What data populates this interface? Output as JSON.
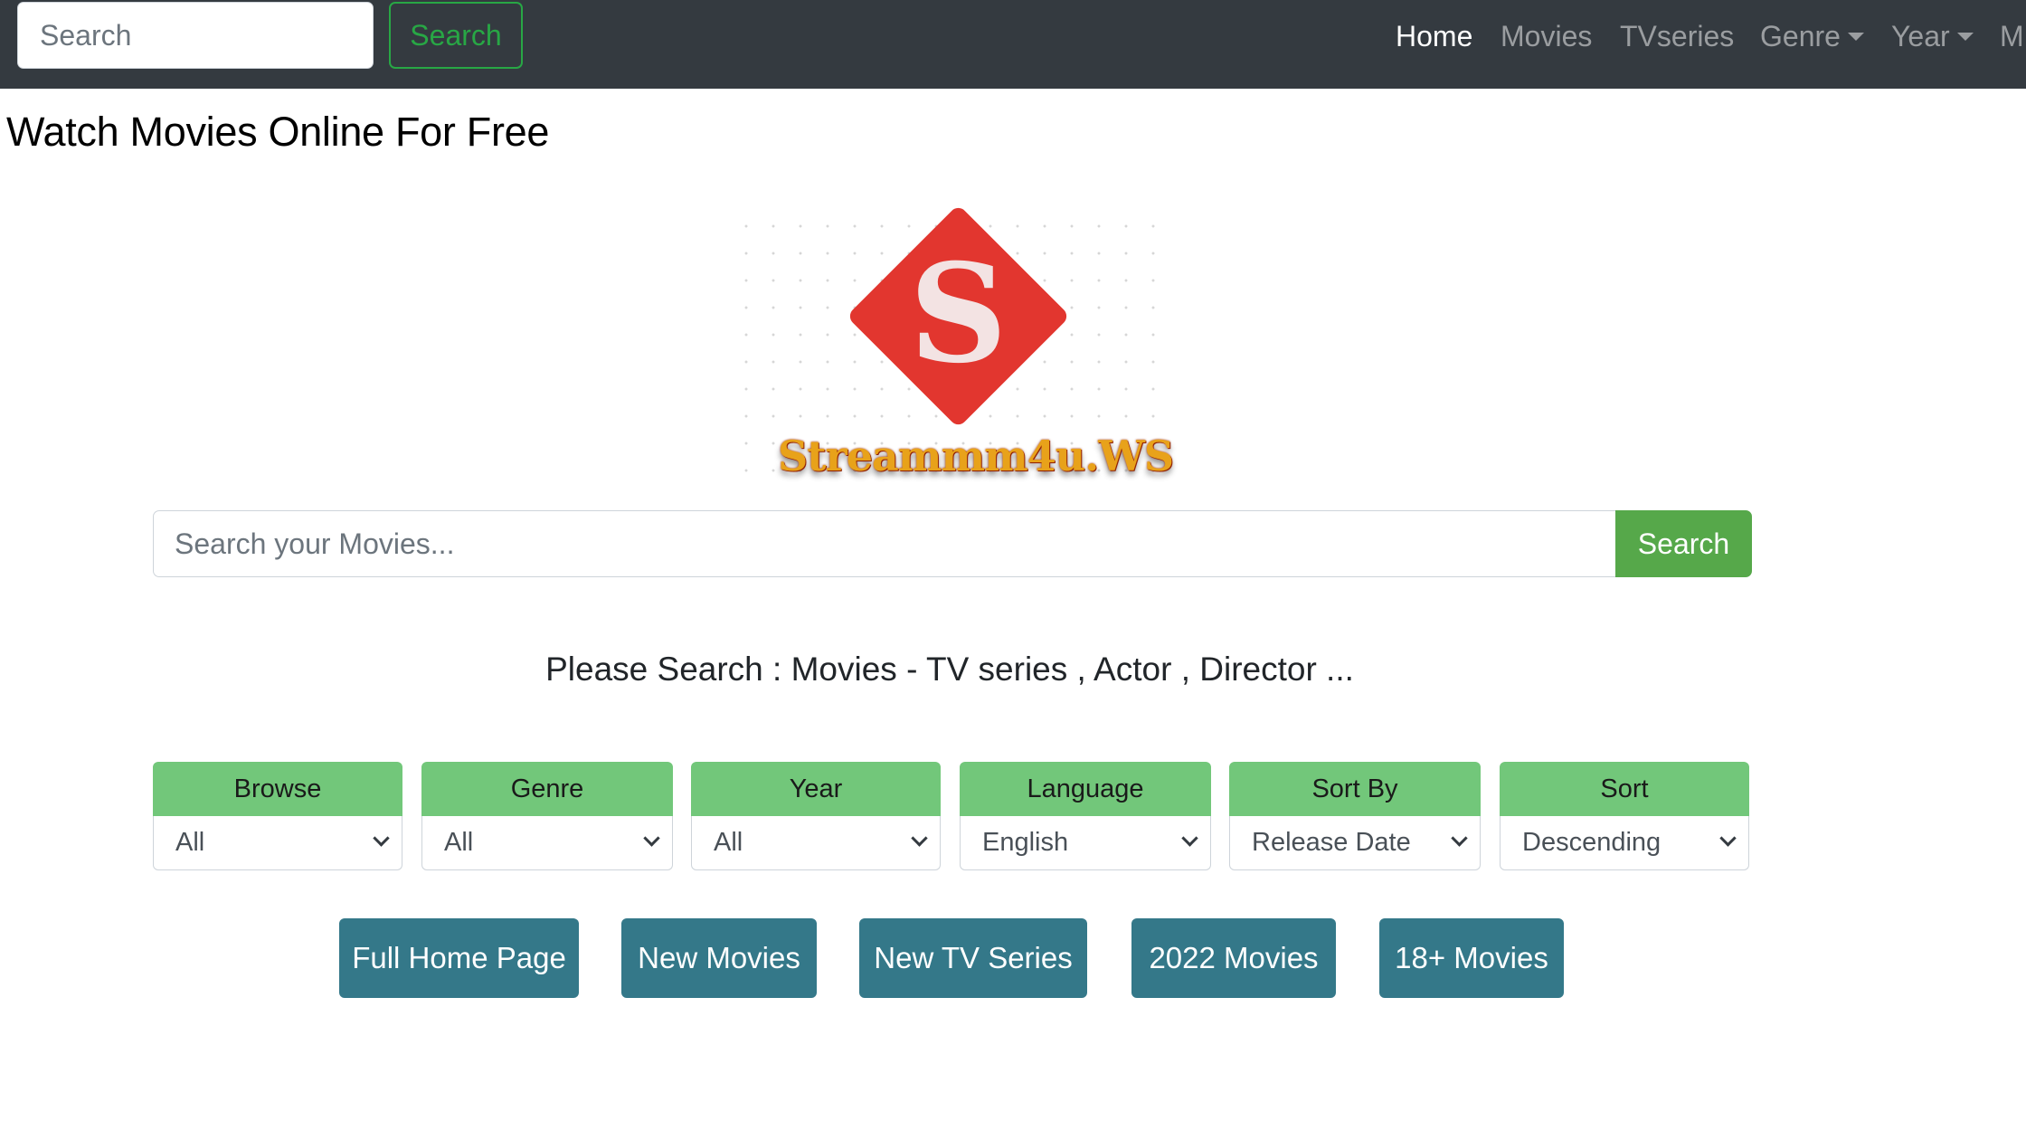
{
  "navbar": {
    "search_placeholder": "Search",
    "search_button": "Search",
    "links": [
      {
        "label": "Home",
        "active": true
      },
      {
        "label": "Movies"
      },
      {
        "label": "TVseries"
      },
      {
        "label": "Genre",
        "dropdown": true
      },
      {
        "label": "Year",
        "dropdown": true
      },
      {
        "label": "M"
      }
    ]
  },
  "page": {
    "title": "Watch Movies Online For Free"
  },
  "logo": {
    "letter": "S",
    "text": "Streammm4u.WS",
    "diamond_color": "#e2362f"
  },
  "main_search": {
    "placeholder": "Search your Movies...",
    "button": "Search"
  },
  "tagline": "Please Search : Movies - TV series , Actor , Director ...",
  "filters": [
    {
      "label": "Browse",
      "value": "All"
    },
    {
      "label": "Genre",
      "value": "All"
    },
    {
      "label": "Year",
      "value": "All"
    },
    {
      "label": "Language",
      "value": "English"
    },
    {
      "label": "Sort By",
      "value": "Release Date"
    },
    {
      "label": "Sort",
      "value": "Descending"
    }
  ],
  "quick_links": [
    {
      "label": "Full Home Page"
    },
    {
      "label": "New Movies"
    },
    {
      "label": "New TV Series"
    },
    {
      "label": "2022 Movies"
    },
    {
      "label": "18+ Movies"
    }
  ],
  "colors": {
    "navbar_bg": "#343a40",
    "success": "#28a745",
    "filter_header": "#72c77a",
    "quick_link_bg": "#347889"
  }
}
